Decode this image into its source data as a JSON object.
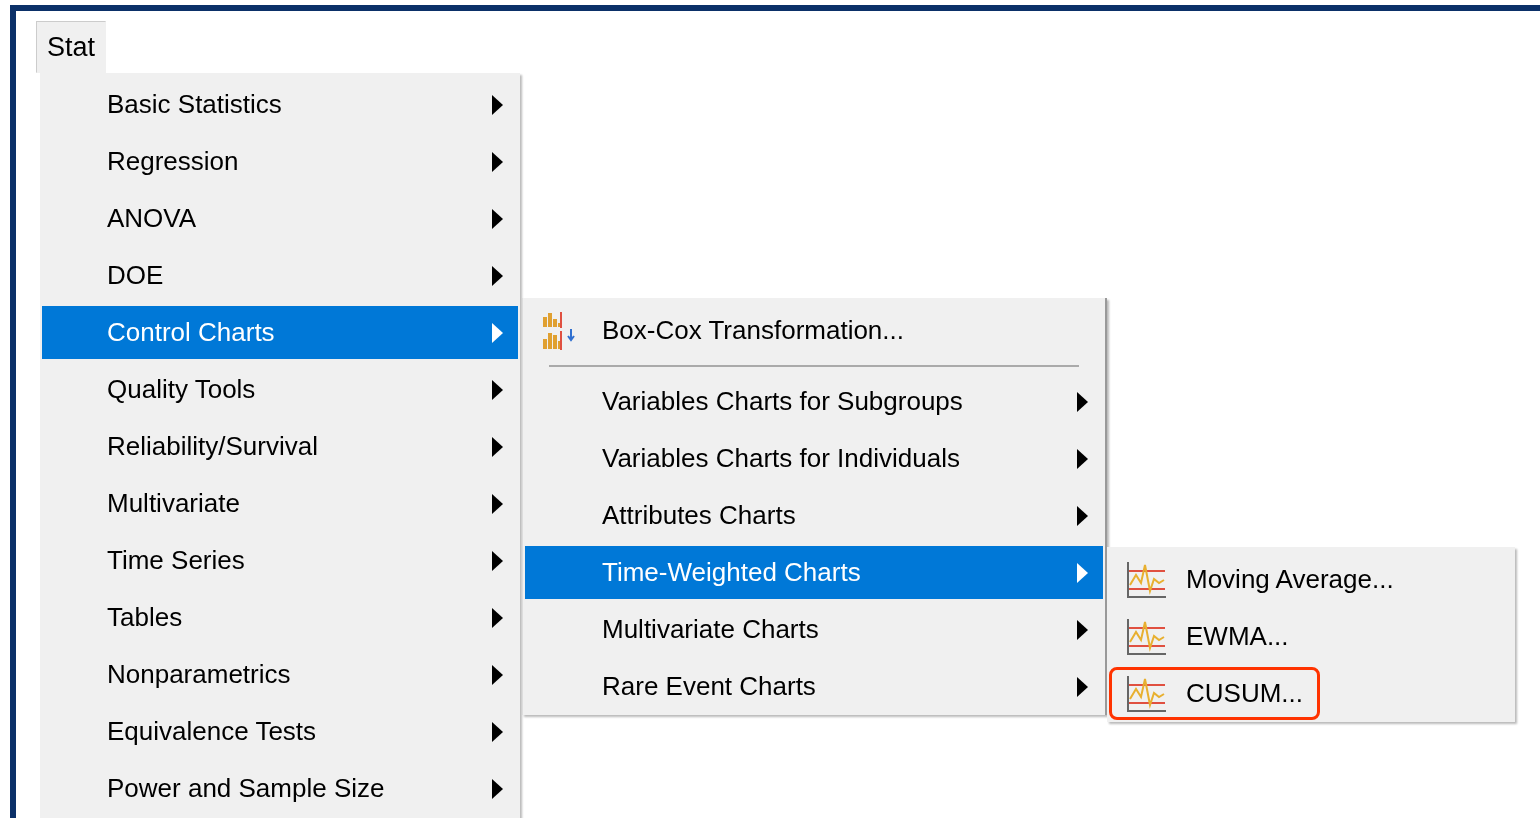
{
  "menu_bar": [
    {
      "label": "Stat",
      "selected": true
    }
  ],
  "menu": {
    "items": [
      {
        "kind": "submenu",
        "label": "Basic Statistics",
        "selected": false
      },
      {
        "kind": "submenu",
        "label": "Regression",
        "selected": false
      },
      {
        "kind": "submenu",
        "label": "ANOVA",
        "selected": false
      },
      {
        "kind": "submenu",
        "label": "DOE",
        "selected": false
      },
      {
        "kind": "submenu",
        "label": "Control Charts",
        "selected": true,
        "submenu": {
          "items": [
            {
              "kind": "transform",
              "label": "Box-Cox Transformation...",
              "selected": false
            },
            {
              "kind": "separator"
            },
            {
              "kind": "submenu",
              "label": "Variables Charts for Subgroups",
              "selected": false
            },
            {
              "kind": "submenu",
              "label": "Variables Charts for Individuals",
              "selected": false
            },
            {
              "kind": "submenu",
              "label": "Attributes Charts",
              "selected": false
            },
            {
              "kind": "submenu",
              "label": "Time-Weighted Charts",
              "selected": true,
              "submenu": {
                "items": [
                  {
                    "kind": "chart",
                    "label": "Moving Average...",
                    "selected": false,
                    "highlighted": false
                  },
                  {
                    "kind": "chart",
                    "label": "EWMA...",
                    "selected": false,
                    "highlighted": false
                  },
                  {
                    "kind": "chart",
                    "label": "CUSUM...",
                    "selected": false,
                    "highlighted": true
                  }
                ]
              }
            },
            {
              "kind": "submenu",
              "label": "Multivariate Charts",
              "selected": false
            },
            {
              "kind": "submenu",
              "label": "Rare Event Charts",
              "selected": false
            }
          ]
        }
      },
      {
        "kind": "submenu",
        "label": "Quality Tools",
        "selected": false
      },
      {
        "kind": "submenu",
        "label": "Reliability/Survival",
        "selected": false
      },
      {
        "kind": "submenu",
        "label": "Multivariate",
        "selected": false
      },
      {
        "kind": "submenu",
        "label": "Time Series",
        "selected": false
      },
      {
        "kind": "submenu",
        "label": "Tables",
        "selected": false
      },
      {
        "kind": "submenu",
        "label": "Nonparametrics",
        "selected": false
      },
      {
        "kind": "submenu",
        "label": "Equivalence Tests",
        "selected": false
      },
      {
        "kind": "submenu",
        "label": "Power and Sample Size",
        "selected": false
      }
    ]
  }
}
